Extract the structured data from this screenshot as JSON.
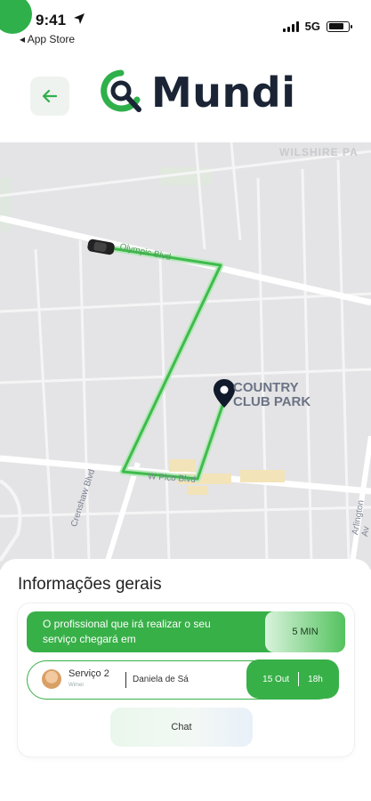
{
  "status_bar": {
    "time": "9:41",
    "back_app": "◂ App Store",
    "network": "5G",
    "battery_level": 0.8
  },
  "header": {
    "back_icon": "arrow-left-icon",
    "logo_text": "Mundi",
    "logo_icon": "magnifier-q-icon",
    "accent_color": "#2fb04b"
  },
  "map": {
    "area_label_line1": "COUNTRY",
    "area_label_line2": "CLUB PARK",
    "top_label": "WILSHIRE PA",
    "streets": [
      "Olympic Blvd",
      "W Pico Blvd",
      "Crenshaw Blvd",
      "Arlington Av"
    ],
    "vehicle_icon": "car-icon",
    "destination_icon": "map-pin-icon",
    "route_color": "#4cc459"
  },
  "panel": {
    "title": "Informações gerais",
    "eta_message": "O profissional que irá realizar o seu serviço chegará em",
    "eta_time": "5 MIN",
    "service": {
      "name": "Serviço 2",
      "subtitle": "Wimer",
      "professional": "Daniela de Sá",
      "date": "15 Out",
      "hour": "18h"
    },
    "chat_label": "Chat"
  }
}
